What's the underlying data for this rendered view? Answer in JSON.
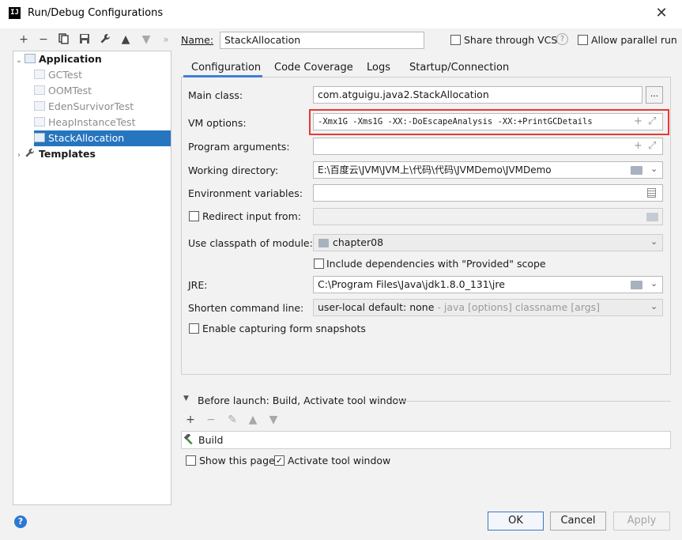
{
  "window": {
    "title": "Run/Debug Configurations",
    "app_icon": "IJ"
  },
  "toolbar": {
    "icons": [
      "add-icon",
      "remove-icon",
      "copy-icon",
      "save-icon",
      "wrench-icon",
      "move-up-icon",
      "move-down-icon",
      "more-icon"
    ],
    "add": "+",
    "remove": "−",
    "more": "»"
  },
  "tree": {
    "application": "Application",
    "items": [
      "GCTest",
      "OOMTest",
      "EdenSurvivorTest",
      "HeapInstanceTest",
      "StackAllocation"
    ],
    "templates": "Templates"
  },
  "name_row": {
    "label": "Name:",
    "value": "StackAllocation",
    "share": "Share through VCS",
    "allow_parallel": "Allow parallel run"
  },
  "tabs": [
    "Configuration",
    "Code Coverage",
    "Logs",
    "Startup/Connection"
  ],
  "form": {
    "main_class_label": "Main class:",
    "main_class_value": "com.atguigu.java2.StackAllocation",
    "browse_label": "...",
    "vm_options_label": "VM options:",
    "vm_options_value": "-Xmx1G -Xms1G -XX:-DoEscapeAnalysis -XX:+PrintGCDetails",
    "program_args_label": "Program arguments:",
    "program_args_value": "",
    "working_dir_label": "Working directory:",
    "working_dir_value": "E:\\百度云\\JVM\\JVM上\\代码\\代码\\JVMDemo\\JVMDemo",
    "env_label": "Environment variables:",
    "env_value": "",
    "redirect_label": "Redirect input from:",
    "classpath_label": "Use classpath of module:",
    "classpath_value": "chapter08",
    "include_deps_label": "Include dependencies with \"Provided\" scope",
    "jre_label": "JRE:",
    "jre_value": "C:\\Program Files\\Java\\jdk1.8.0_131\\jre",
    "shorten_label": "Shorten command line:",
    "shorten_value": "user-local default: none",
    "shorten_hint": " - java [options] classname [args]",
    "snapshots_label": "Enable capturing form snapshots"
  },
  "before_launch": {
    "title": "Before launch: Build, Activate tool window",
    "task": "Build",
    "show_page": "Show this page",
    "activate_tool_window": "Activate tool window"
  },
  "buttons": {
    "ok": "OK",
    "cancel": "Cancel",
    "apply": "Apply",
    "help": "?"
  },
  "colors": {
    "selection": "#2675bf",
    "highlight_box": "#e53935",
    "tab_underline": "#3f7fd6",
    "help": "#2b78d4"
  }
}
